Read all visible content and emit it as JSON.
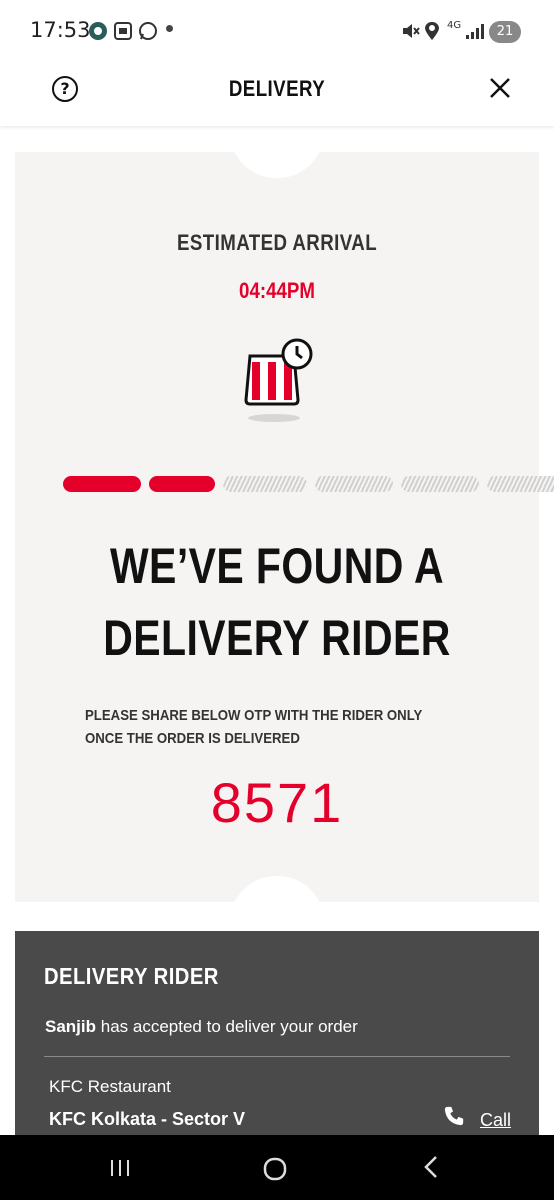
{
  "status_bar": {
    "time": "17:53",
    "network": "4G",
    "notification_count": "21",
    "icons": [
      "chat-app-icon",
      "screenshot-icon",
      "whatsapp-icon",
      "mute-icon",
      "location-icon",
      "signal-icon"
    ]
  },
  "header": {
    "title": "DELIVERY",
    "help_icon": "?",
    "close_icon": "close-icon"
  },
  "tracker": {
    "eta_label": "ESTIMATED ARRIVAL",
    "eta_time": "04:44PM",
    "progress": {
      "completed_steps": 2,
      "total_steps": 6
    },
    "headline_line1": "WE’VE FOUND A",
    "headline_line2": "DELIVERY RIDER",
    "otp_instruction": "PLEASE SHARE BELOW OTP WITH THE RIDER ONLY ONCE THE ORDER IS DELIVERED",
    "otp": "8571"
  },
  "rider": {
    "title": "DELIVERY RIDER",
    "name": "Sanjib",
    "message": " has accepted to deliver your order",
    "restaurant_label": "KFC Restaurant",
    "restaurant_name": "KFC Kolkata - Sector V",
    "call_label": "Call"
  },
  "colors": {
    "accent": "#e4002b",
    "card_bg": "#f6f4f3",
    "rider_bg": "#4a4a4a"
  }
}
